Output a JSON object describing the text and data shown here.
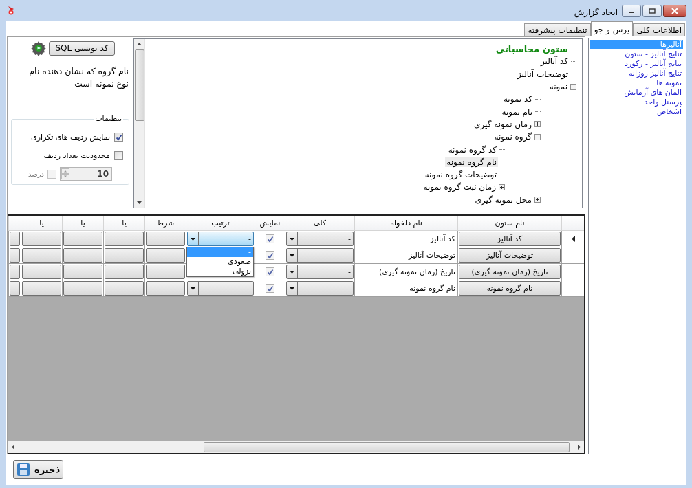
{
  "window": {
    "title": "ایجاد گزارش"
  },
  "tabs": [
    {
      "label": "اطلاعات کلی",
      "selected": false
    },
    {
      "label": "پرس و جو",
      "selected": true
    },
    {
      "label": "تنظیمات پیشرفته",
      "selected": false
    }
  ],
  "sources": [
    {
      "label": "آنالیزها",
      "selected": true
    },
    {
      "label": "تنایج آنالیز - ستون",
      "selected": false
    },
    {
      "label": "تنایج آنالیز - رکورد",
      "selected": false
    },
    {
      "label": "تنایج آنالیز روزانه",
      "selected": false
    },
    {
      "label": "نمونه ها",
      "selected": false
    },
    {
      "label": "المان های آزمایش",
      "selected": false
    },
    {
      "label": "پرسنل واحد",
      "selected": false
    },
    {
      "label": "اشخاص",
      "selected": false
    }
  ],
  "sql_button": "کد نویسی SQL",
  "description": "نام گروه که نشان دهنده نام نوع نمونه است",
  "settings": {
    "title": "تنظیمات",
    "options": [
      {
        "label": "نمایش ردیف های تکراری",
        "checked": true
      },
      {
        "label": "محدودیت تعداد ردیف",
        "checked": false
      }
    ],
    "row_limit": {
      "value": "10",
      "disabled": true
    },
    "percent": {
      "label": "درصد",
      "checked": false,
      "disabled": true
    }
  },
  "tree": [
    {
      "label": "ستون محاسباتی",
      "kind": "computed",
      "selected": false
    },
    {
      "label": "کد آنالیز",
      "kind": "field",
      "selected": false
    },
    {
      "label": "توضیحات آنالیز",
      "kind": "field",
      "selected": false
    },
    {
      "label": "نمونه",
      "kind": "group",
      "expanded": true,
      "selected": false,
      "children": [
        {
          "label": "کد نمونه",
          "kind": "field",
          "selected": false
        },
        {
          "label": "نام نمونه",
          "kind": "field",
          "selected": false
        },
        {
          "label": "زمان نمونه گیری",
          "kind": "group",
          "expanded": false,
          "selected": false
        },
        {
          "label": "گروه نمونه",
          "kind": "group",
          "expanded": true,
          "selected": false,
          "children": [
            {
              "label": "کد گروه نمونه",
              "kind": "field",
              "selected": false
            },
            {
              "label": "نام گروه نمونه",
              "kind": "field",
              "selected": true
            },
            {
              "label": "توضیحات گروه نمونه",
              "kind": "field",
              "selected": false
            },
            {
              "label": "زمان ثبت گروه نمونه",
              "kind": "group",
              "expanded": false,
              "selected": false
            }
          ]
        },
        {
          "label": "محل نمونه گیری",
          "kind": "group",
          "expanded": false,
          "selected": false
        }
      ]
    }
  ],
  "grid": {
    "columns": [
      "نام ستون",
      "نام دلخواه",
      "کلی",
      "نمایش",
      "ترتیب",
      "شرط",
      "یا",
      "یا",
      "یا"
    ],
    "rows": [
      {
        "column": "کد آنالیز",
        "alias": "کد آنالیز",
        "aggregate": "-",
        "visible": true,
        "sort": "-",
        "current": true
      },
      {
        "column": "توضیحات آنالیز",
        "alias": "توضیحات آنالیز",
        "aggregate": "-",
        "visible": true,
        "current": false
      },
      {
        "column": "تاریخ (زمان نمونه گیری)",
        "alias": "تاریخ (زمان نمونه گیری)",
        "aggregate": "-",
        "visible": true,
        "current": false
      },
      {
        "column": "نام گروه نمونه",
        "alias": "نام گروه نمونه",
        "aggregate": "-",
        "visible": true,
        "sort": "-",
        "current": false
      }
    ],
    "sort_dropdown": [
      {
        "label": "-",
        "selected": true
      },
      {
        "label": "صعودی",
        "selected": false
      },
      {
        "label": "نزولی",
        "selected": false
      }
    ]
  },
  "save_button": "ذخیره"
}
